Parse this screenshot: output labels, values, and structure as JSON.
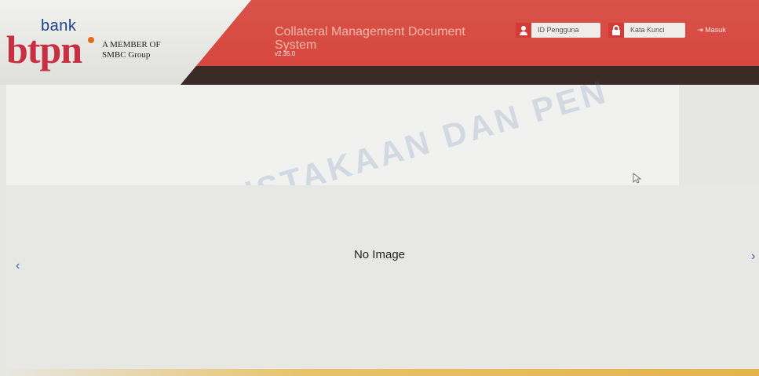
{
  "logo": {
    "bank": "bank",
    "btpn": "btpn",
    "member_line1": "A MEMBER OF",
    "member_line2": "SMBC Group"
  },
  "header": {
    "title_line1": "Collateral Management Document",
    "title_line2": "System",
    "version": "v2.35.0"
  },
  "login": {
    "user_id_placeholder": "ID Pengguna",
    "password_placeholder": "Kata Kunci",
    "login_button": "Masuk"
  },
  "carousel": {
    "content_text": "No Image",
    "prev_glyph": "‹",
    "next_glyph": "›"
  },
  "watermark": {
    "text": "PERPUSTAKAAN DAN PEN"
  },
  "colors": {
    "header_red": "#d4433b",
    "brand_blue": "#1e3f92",
    "brand_red": "#c63042"
  },
  "icons": {
    "user": "user-icon",
    "lock": "lock-icon",
    "login": "login-icon",
    "prev": "chevron-left-icon",
    "next": "chevron-right-icon"
  }
}
